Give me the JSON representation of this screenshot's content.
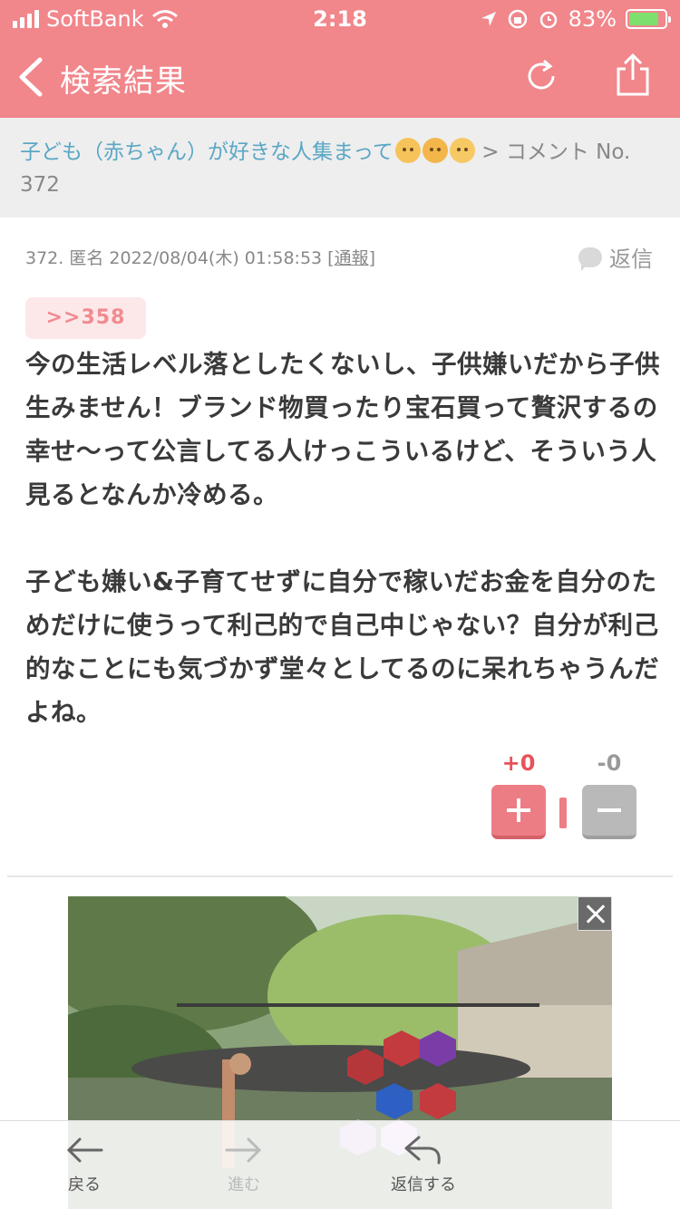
{
  "status_bar": {
    "carrier": "SoftBank",
    "time": "2:18",
    "battery": "83%",
    "battery_level": 0.83
  },
  "nav": {
    "title": "検索結果"
  },
  "breadcrumb": {
    "thread_title": "子ども（赤ちゃん）が好きな人集まって",
    "separator": ">",
    "current": "コメント No. 372"
  },
  "comment": {
    "number": "372.",
    "author": "匿名",
    "datetime": "2022/08/04(木) 01:58:53",
    "report_label": "通報",
    "reply_label": "返信",
    "anchor": ">>358",
    "paragraphs": [
      "今の生活レベル落としたくないし、子供嫌いだから子供生みません！ブランド物買ったり宝石買って贅沢するの幸せ〜って公言してる人けっこういるけど、そういう人見るとなんか冷める。",
      "子ども嫌い&子育てせずに自分で稼いだお金を自分のためだけに使うって利己的で自己中じゃない？自分が利己的なことにも気づかず堂々としてるのに呆れちゃうんだよね。"
    ],
    "votes": {
      "plus": "+0",
      "minus": "-0"
    }
  },
  "toolbar": {
    "back_label": "戻る",
    "forward_label": "進む",
    "reply_label": "返信する"
  },
  "colors": {
    "header": "#f1868b",
    "link": "#5aa7c4",
    "plus": "#e8525a"
  }
}
